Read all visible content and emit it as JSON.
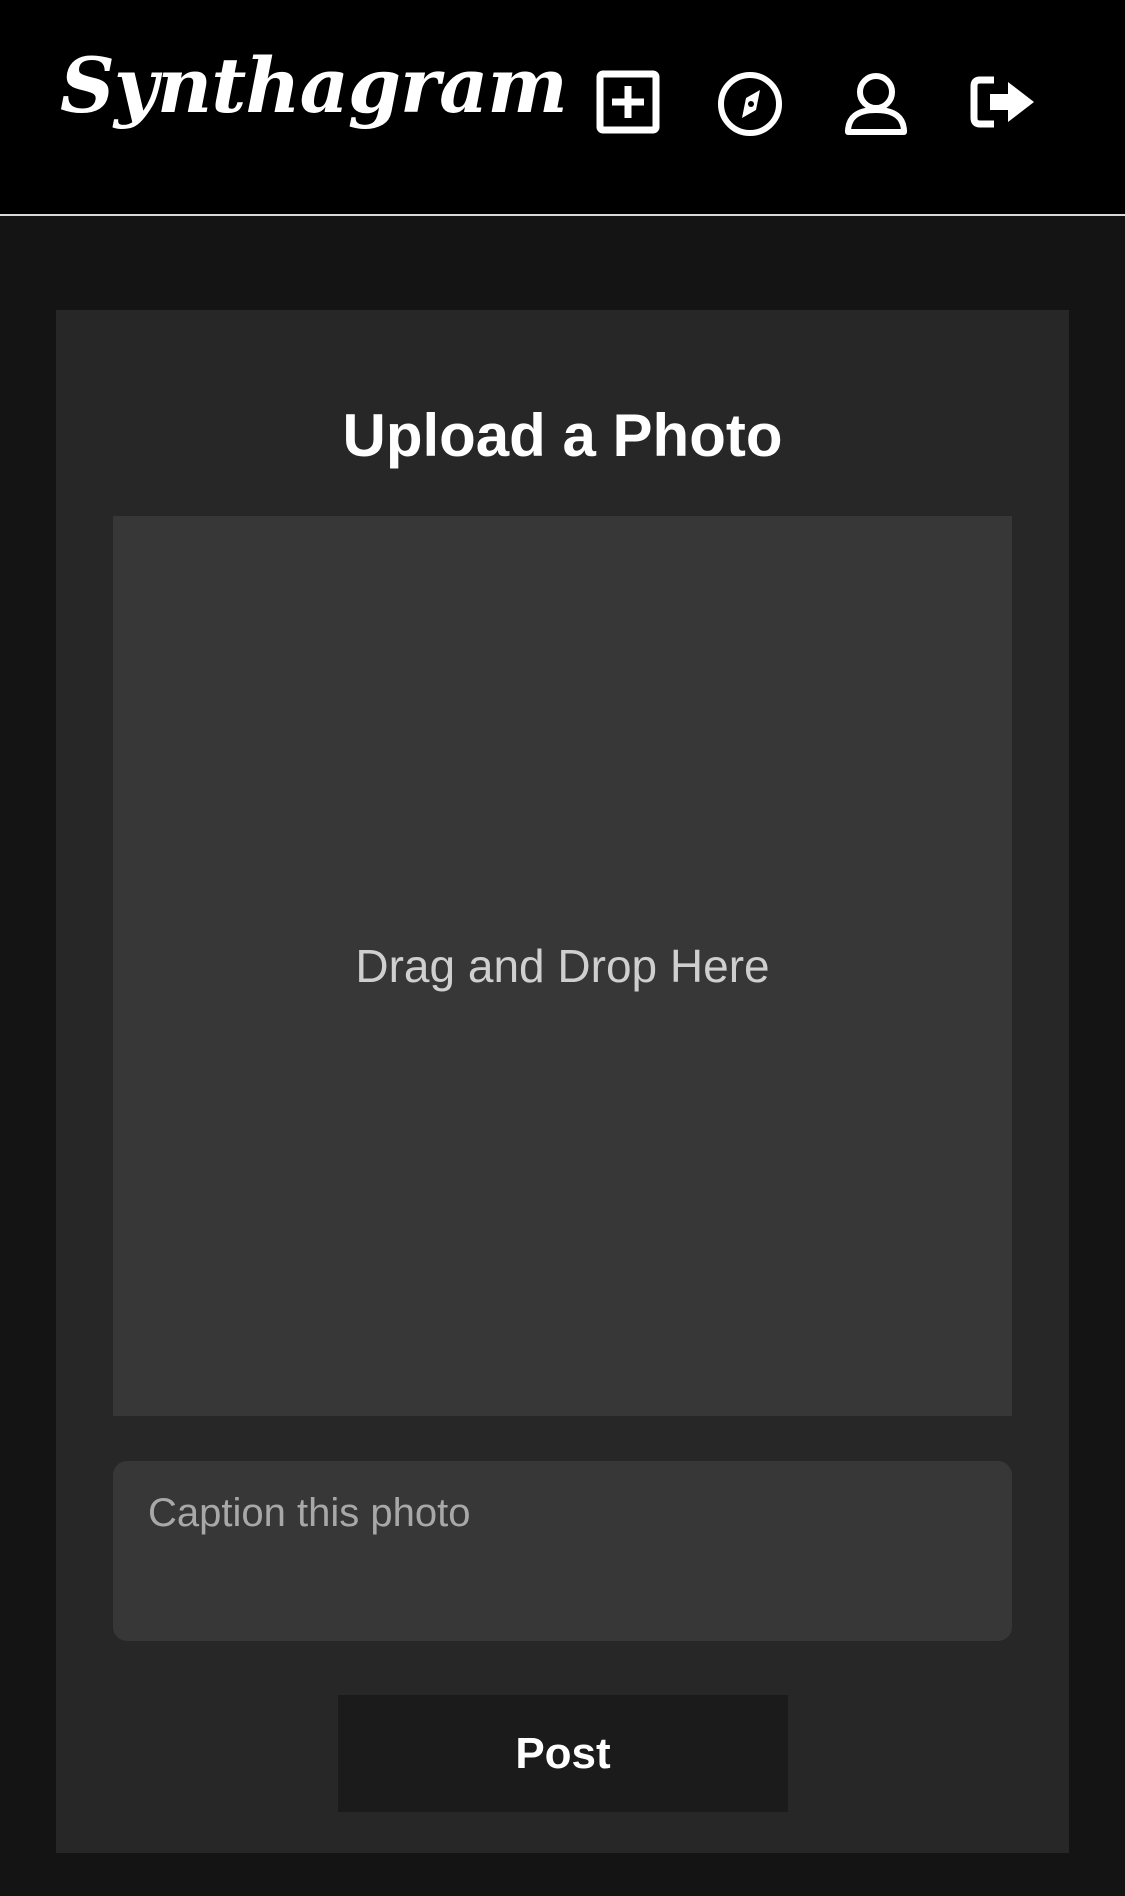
{
  "header": {
    "logo_text": "Synthagram",
    "nav_icons": [
      "add-post-icon",
      "explore-compass-icon",
      "profile-user-icon",
      "logout-icon"
    ]
  },
  "upload": {
    "title": "Upload a Photo",
    "dropzone_text": "Drag and Drop Here",
    "caption_placeholder": "Caption this photo",
    "caption_value": "",
    "post_label": "Post"
  },
  "colors": {
    "header_bg": "#000000",
    "page_bg": "#141414",
    "card_bg": "#272727",
    "dropzone_bg": "#373737",
    "button_bg": "#1b1b1b",
    "text": "#ffffff"
  }
}
